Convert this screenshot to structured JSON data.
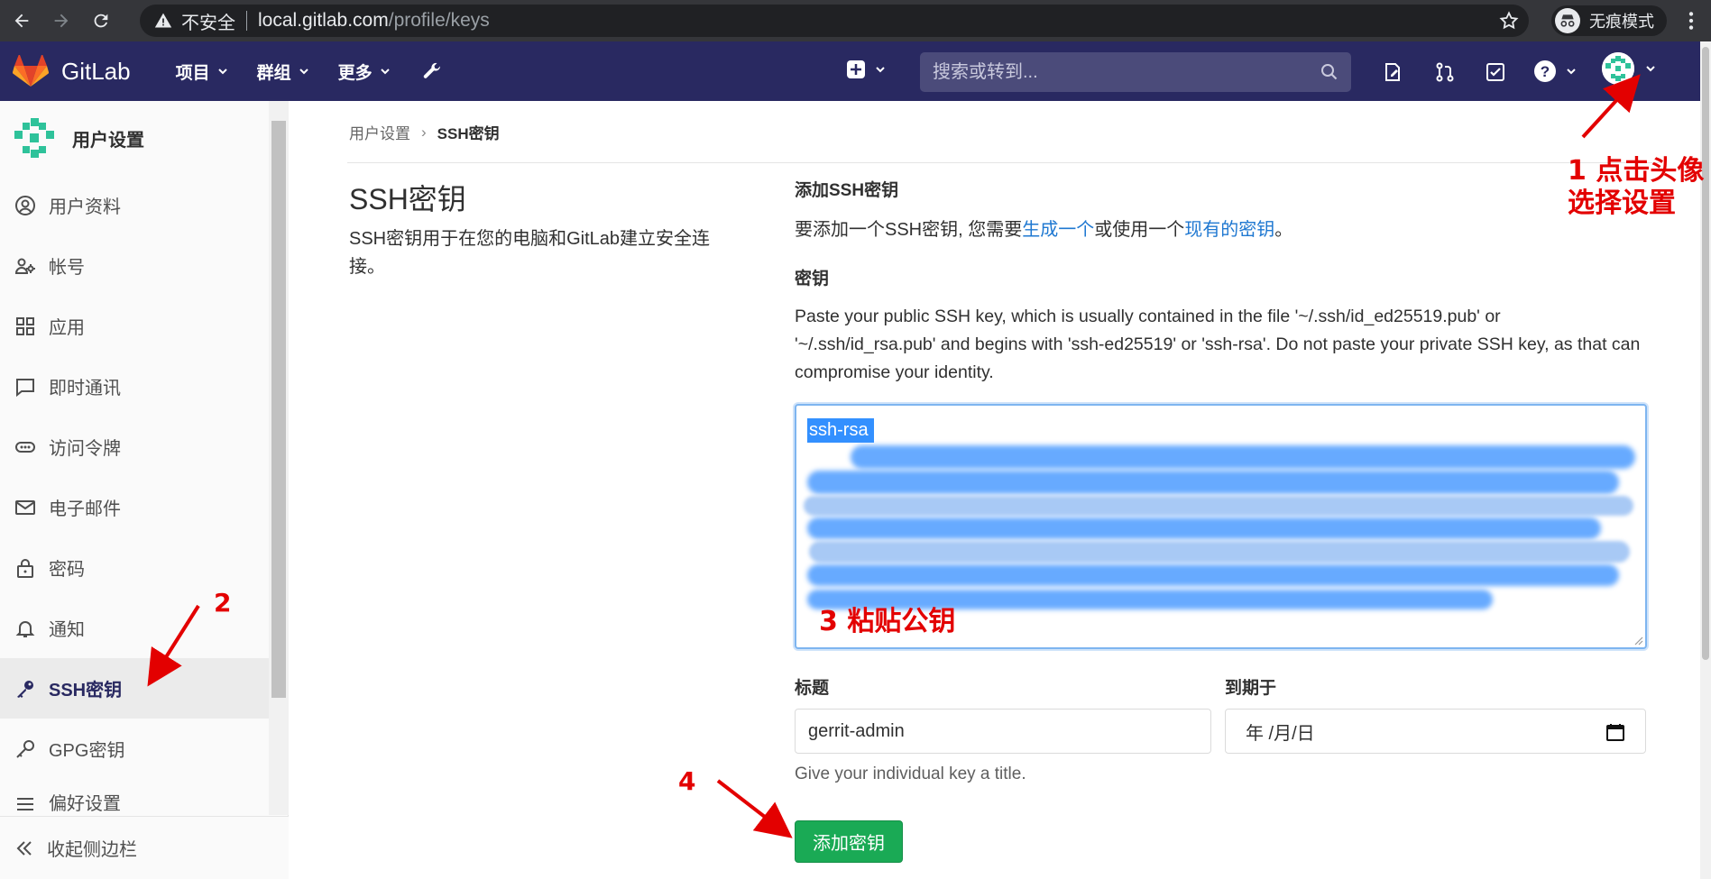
{
  "browser": {
    "insecure_label": "不安全",
    "url_host": "local.gitlab.com",
    "url_path": "/profile/keys",
    "incognito_label": "无痕模式"
  },
  "navbar": {
    "brand": "GitLab",
    "menu": [
      "项目",
      "群组",
      "更多"
    ],
    "search_placeholder": "搜索或转到..."
  },
  "sidebar": {
    "title": "用户设置",
    "items": [
      {
        "label": "用户资料",
        "icon": "profile-icon"
      },
      {
        "label": "帐号",
        "icon": "account-icon"
      },
      {
        "label": "应用",
        "icon": "applications-icon"
      },
      {
        "label": "即时通讯",
        "icon": "chat-icon"
      },
      {
        "label": "访问令牌",
        "icon": "token-icon"
      },
      {
        "label": "电子邮件",
        "icon": "mail-icon"
      },
      {
        "label": "密码",
        "icon": "lock-icon"
      },
      {
        "label": "通知",
        "icon": "bell-icon"
      },
      {
        "label": "SSH密钥",
        "icon": "key-icon"
      },
      {
        "label": "GPG密钥",
        "icon": "key-icon"
      },
      {
        "label": "偏好设置",
        "icon": "preferences-icon"
      }
    ],
    "active_index": 8,
    "collapse_label": "收起侧边栏"
  },
  "breadcrumb": {
    "parent": "用户设置",
    "current": "SSH密钥"
  },
  "page": {
    "title": "SSH密钥",
    "description": "SSH密钥用于在您的电脑和GitLab建立安全连接。"
  },
  "form": {
    "add_heading": "添加SSH密钥",
    "add_text_before": "要添加一个SSH密钥, 您需要",
    "add_link_generate": "生成一个",
    "add_text_middle": "或使用一个",
    "add_link_existing": "现有的密钥",
    "add_text_after": "。",
    "key_label": "密钥",
    "key_description": "Paste your public SSH key, which is usually contained in the file '~/.ssh/id_ed25519.pub' or '~/.ssh/id_rsa.pub' and begins with 'ssh-ed25519' or 'ssh-rsa'. Do not paste your private SSH key, as that can compromise your identity.",
    "key_value_visible": "ssh-rsa",
    "title_label": "标题",
    "title_value": "gerrit-admin",
    "title_hint": "Give your individual key a title.",
    "expires_label": "到期于",
    "expires_placeholder": "年 /月/日",
    "submit_label": "添加密钥"
  },
  "annotations": {
    "step1": "1 点击头像\n选择设置",
    "step2": "2",
    "step3": "3 粘贴公钥",
    "step4": "4",
    "color": "#e30000"
  },
  "colors": {
    "navbar_bg": "#292961",
    "chrome_bg": "#35363a",
    "link": "#1f78d1",
    "submit_bg": "#1aaa55"
  }
}
